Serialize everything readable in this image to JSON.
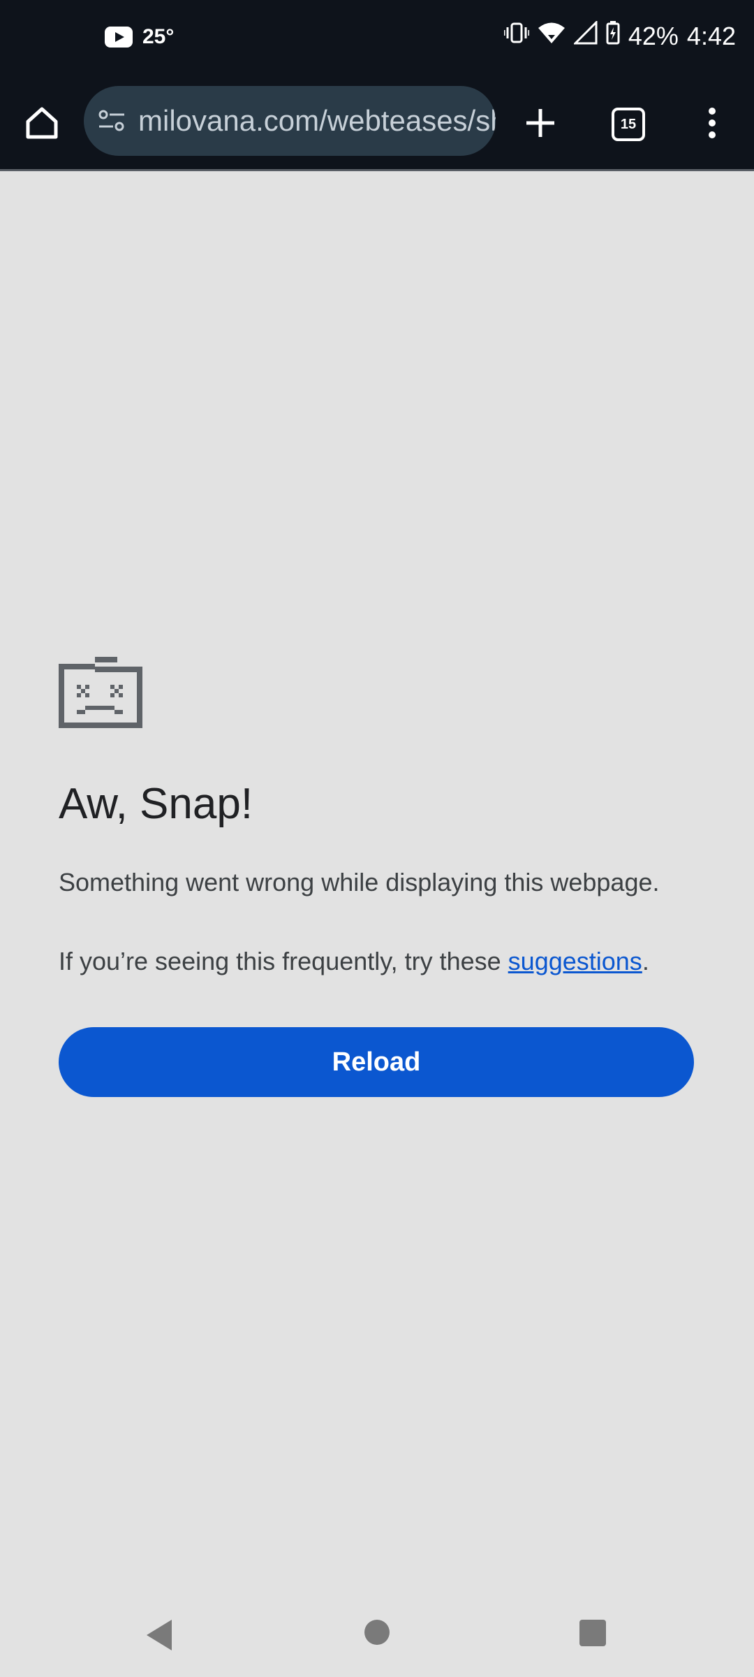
{
  "status_bar": {
    "temperature": "25°",
    "battery": "42%",
    "time": "4:42",
    "icons": [
      "youtube-icon",
      "vibrate-icon",
      "wifi-icon",
      "signal-icon",
      "battery-charging-icon"
    ]
  },
  "toolbar": {
    "url": "milovana.com/webteases/showtease.php",
    "tab_count": "15",
    "icons": [
      "home-icon",
      "site-settings-icon",
      "new-tab-icon",
      "tab-switcher-icon",
      "menu-icon"
    ]
  },
  "error_page": {
    "icon": "sad-folder-icon",
    "title": "Aw, Snap!",
    "message": "Something went wrong while displaying this webpage.",
    "hint_prefix": "If you’re seeing this frequently, try these ",
    "hint_link": "suggestions",
    "hint_suffix": ".",
    "reload_label": "Reload"
  },
  "nav_bar": {
    "icons": [
      "back-icon",
      "home-circle-icon",
      "recents-icon"
    ]
  },
  "colors": {
    "status_bg": "#0e131b",
    "omnibox_bg": "#2a3b48",
    "page_bg": "#e2e2e2",
    "accent": "#0b57d0"
  }
}
